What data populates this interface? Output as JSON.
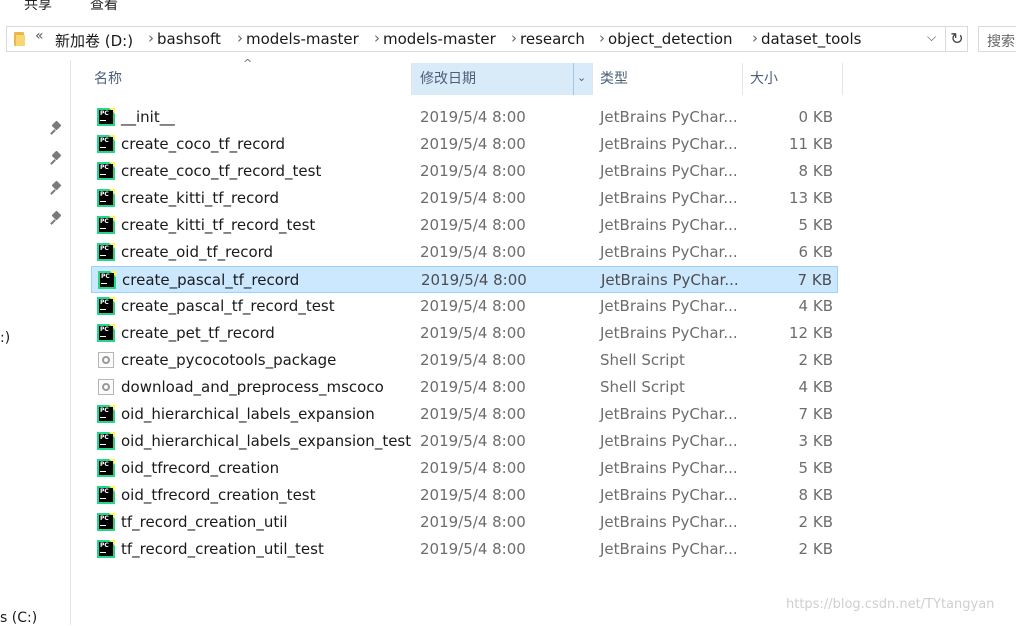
{
  "ribbon": {
    "tab_share": "共享",
    "tab_view": "查看"
  },
  "address": {
    "overflow": "«",
    "crumbs": [
      "新加卷 (D:)",
      "bashsoft",
      "models-master",
      "models-master",
      "research",
      "object_detection",
      "dataset_tools"
    ],
    "separator": "›",
    "dropdown_icon": "chevron-down",
    "refresh_icon": "↻"
  },
  "search": {
    "placeholder": "搜索"
  },
  "nav": {
    "drive_d": ":)",
    "drive_c": "s (C:)"
  },
  "columns": {
    "name": "名称",
    "date": "修改日期",
    "type": "类型",
    "size": "大小",
    "sort_arrow": "^",
    "date_chevron": "⌄"
  },
  "files": [
    {
      "name": "__init__",
      "date": "2019/5/4 8:00",
      "type": "JetBrains PyChar...",
      "size": "0 KB",
      "icon": "pycharm-file-icon"
    },
    {
      "name": "create_coco_tf_record",
      "date": "2019/5/4 8:00",
      "type": "JetBrains PyChar...",
      "size": "11 KB",
      "icon": "pycharm-file-icon"
    },
    {
      "name": "create_coco_tf_record_test",
      "date": "2019/5/4 8:00",
      "type": "JetBrains PyChar...",
      "size": "8 KB",
      "icon": "pycharm-file-icon"
    },
    {
      "name": "create_kitti_tf_record",
      "date": "2019/5/4 8:00",
      "type": "JetBrains PyChar...",
      "size": "13 KB",
      "icon": "pycharm-file-icon"
    },
    {
      "name": "create_kitti_tf_record_test",
      "date": "2019/5/4 8:00",
      "type": "JetBrains PyChar...",
      "size": "5 KB",
      "icon": "pycharm-file-icon"
    },
    {
      "name": "create_oid_tf_record",
      "date": "2019/5/4 8:00",
      "type": "JetBrains PyChar...",
      "size": "6 KB",
      "icon": "pycharm-file-icon"
    },
    {
      "name": "create_pascal_tf_record",
      "date": "2019/5/4 8:00",
      "type": "JetBrains PyChar...",
      "size": "7 KB",
      "icon": "pycharm-file-icon",
      "selected": true
    },
    {
      "name": "create_pascal_tf_record_test",
      "date": "2019/5/4 8:00",
      "type": "JetBrains PyChar...",
      "size": "4 KB",
      "icon": "pycharm-file-icon"
    },
    {
      "name": "create_pet_tf_record",
      "date": "2019/5/4 8:00",
      "type": "JetBrains PyChar...",
      "size": "12 KB",
      "icon": "pycharm-file-icon"
    },
    {
      "name": "create_pycocotools_package",
      "date": "2019/5/4 8:00",
      "type": "Shell Script",
      "size": "2 KB",
      "icon": "shell-script-icon"
    },
    {
      "name": "download_and_preprocess_mscoco",
      "date": "2019/5/4 8:00",
      "type": "Shell Script",
      "size": "4 KB",
      "icon": "shell-script-icon"
    },
    {
      "name": "oid_hierarchical_labels_expansion",
      "date": "2019/5/4 8:00",
      "type": "JetBrains PyChar...",
      "size": "7 KB",
      "icon": "pycharm-file-icon"
    },
    {
      "name": "oid_hierarchical_labels_expansion_test",
      "date": "2019/5/4 8:00",
      "type": "JetBrains PyChar...",
      "size": "3 KB",
      "icon": "pycharm-file-icon"
    },
    {
      "name": "oid_tfrecord_creation",
      "date": "2019/5/4 8:00",
      "type": "JetBrains PyChar...",
      "size": "5 KB",
      "icon": "pycharm-file-icon"
    },
    {
      "name": "oid_tfrecord_creation_test",
      "date": "2019/5/4 8:00",
      "type": "JetBrains PyChar...",
      "size": "8 KB",
      "icon": "pycharm-file-icon"
    },
    {
      "name": "tf_record_creation_util",
      "date": "2019/5/4 8:00",
      "type": "JetBrains PyChar...",
      "size": "2 KB",
      "icon": "pycharm-file-icon"
    },
    {
      "name": "tf_record_creation_util_test",
      "date": "2019/5/4 8:00",
      "type": "JetBrains PyChar...",
      "size": "2 KB",
      "icon": "pycharm-file-icon"
    }
  ],
  "watermark": "https://blog.csdn.net/TYtangyan",
  "colors": {
    "selection_bg": "#cce8ff",
    "selection_border": "#99d1ff",
    "sorted_header_bg": "#d9ebf9",
    "pycharm_green": "#21d789"
  }
}
